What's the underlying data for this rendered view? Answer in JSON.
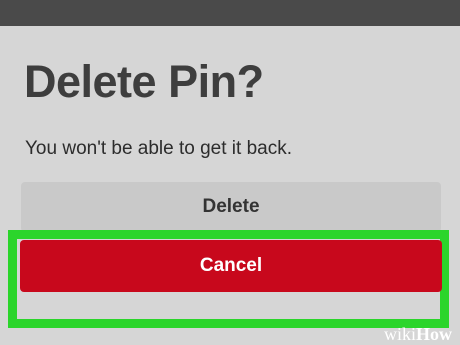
{
  "dialog": {
    "title": "Delete Pin?",
    "message": "You won't be able to get it back.",
    "delete_label": "Delete",
    "cancel_label": "Cancel"
  },
  "watermark": {
    "part1": "wiki",
    "part2": "How"
  },
  "colors": {
    "top_bar": "#4a4a4a",
    "background": "#d6d6d6",
    "delete_button": "#c9c9c9",
    "cancel_button": "#c8081c",
    "highlight": "#2bd52b"
  }
}
